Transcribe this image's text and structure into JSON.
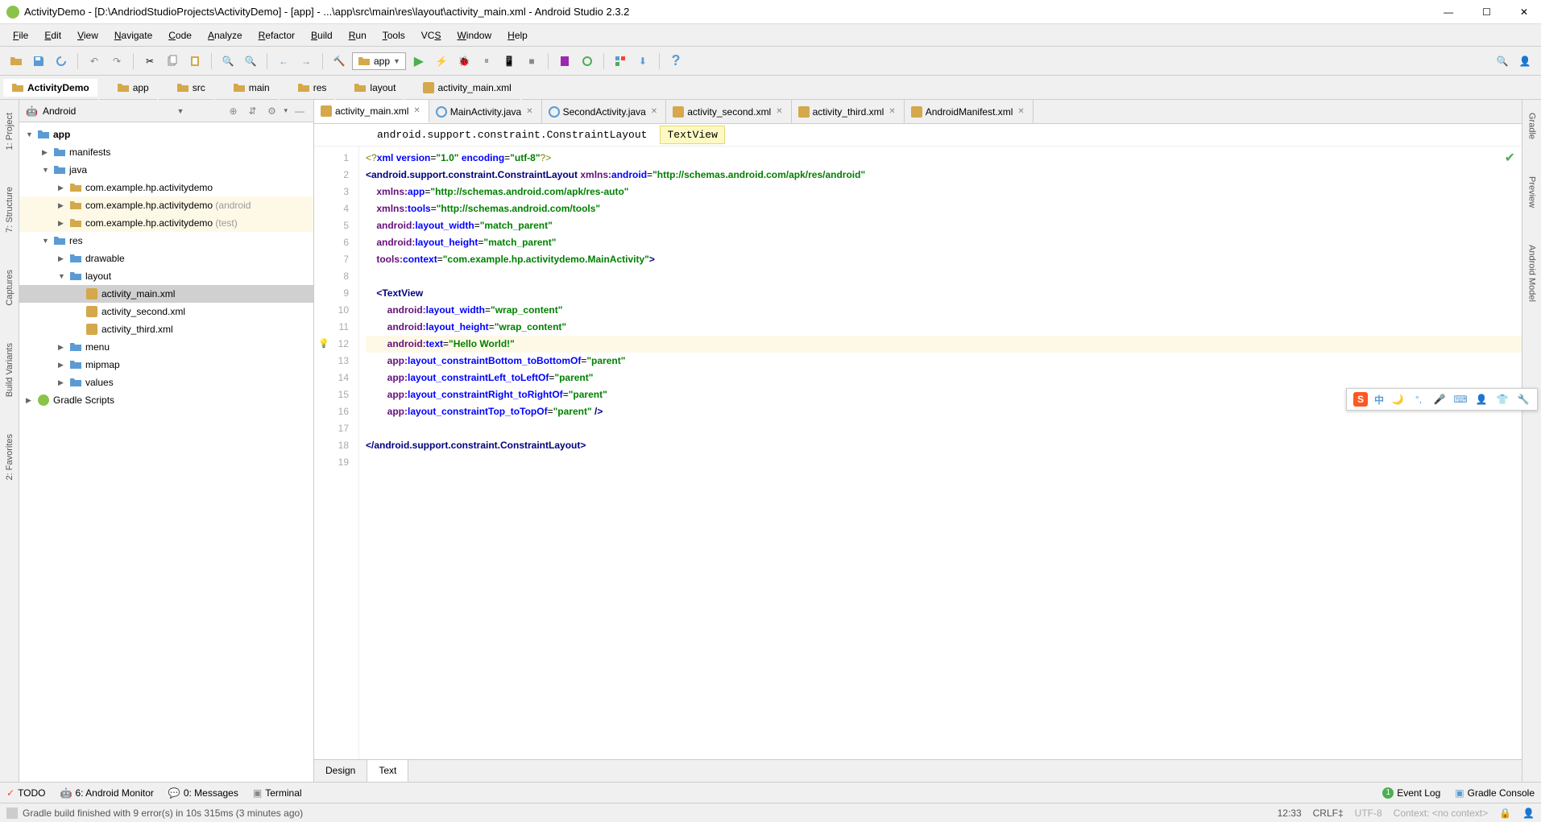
{
  "titlebar": {
    "title": "ActivityDemo - [D:\\AndriodStudioProjects\\ActivityDemo] - [app] - ...\\app\\src\\main\\res\\layout\\activity_main.xml - Android Studio 2.3.2"
  },
  "menubar": [
    {
      "label": "File",
      "key": "F"
    },
    {
      "label": "Edit",
      "key": "E"
    },
    {
      "label": "View",
      "key": "V"
    },
    {
      "label": "Navigate",
      "key": "N"
    },
    {
      "label": "Code",
      "key": "C"
    },
    {
      "label": "Analyze",
      "key": "A"
    },
    {
      "label": "Refactor",
      "key": "R"
    },
    {
      "label": "Build",
      "key": "B"
    },
    {
      "label": "Run",
      "key": "R"
    },
    {
      "label": "Tools",
      "key": "T"
    },
    {
      "label": "VCS",
      "key": "S"
    },
    {
      "label": "Window",
      "key": "W"
    },
    {
      "label": "Help",
      "key": "H"
    }
  ],
  "toolbar": {
    "run_config": "app"
  },
  "breadcrumb": [
    {
      "label": "ActivityDemo",
      "icon": "folder"
    },
    {
      "label": "app",
      "icon": "folder"
    },
    {
      "label": "src",
      "icon": "folder"
    },
    {
      "label": "main",
      "icon": "folder"
    },
    {
      "label": "res",
      "icon": "folder"
    },
    {
      "label": "layout",
      "icon": "folder"
    },
    {
      "label": "activity_main.xml",
      "icon": "xml"
    }
  ],
  "side_tabs_left": [
    {
      "label": "1: Project"
    },
    {
      "label": "7: Structure"
    },
    {
      "label": "Captures"
    },
    {
      "label": "Build Variants"
    },
    {
      "label": "2: Favorites"
    }
  ],
  "side_tabs_right": [
    {
      "label": "Gradle"
    },
    {
      "label": "Preview"
    },
    {
      "label": "Android Model"
    }
  ],
  "project_panel": {
    "view": "Android",
    "tree": [
      {
        "label": "app",
        "icon": "folder",
        "expanded": true,
        "bold": true,
        "indent": 0
      },
      {
        "label": "manifests",
        "icon": "folder",
        "expanded": false,
        "indent": 1
      },
      {
        "label": "java",
        "icon": "folder",
        "expanded": true,
        "indent": 1
      },
      {
        "label": "com.example.hp.activitydemo",
        "icon": "package",
        "expanded": false,
        "indent": 2
      },
      {
        "label": "com.example.hp.activitydemo",
        "suffix": " (android",
        "icon": "package",
        "expanded": false,
        "indent": 2,
        "highlighted": true
      },
      {
        "label": "com.example.hp.activitydemo",
        "suffix": " (test)",
        "icon": "package",
        "expanded": false,
        "indent": 2,
        "highlighted": true
      },
      {
        "label": "res",
        "icon": "folder",
        "expanded": true,
        "indent": 1
      },
      {
        "label": "drawable",
        "icon": "folder",
        "expanded": false,
        "indent": 2
      },
      {
        "label": "layout",
        "icon": "folder",
        "expanded": true,
        "indent": 2
      },
      {
        "label": "activity_main.xml",
        "icon": "xml",
        "indent": 3,
        "selected": true
      },
      {
        "label": "activity_second.xml",
        "icon": "xml",
        "indent": 3
      },
      {
        "label": "activity_third.xml",
        "icon": "xml",
        "indent": 3
      },
      {
        "label": "menu",
        "icon": "folder",
        "expanded": false,
        "indent": 2
      },
      {
        "label": "mipmap",
        "icon": "folder",
        "expanded": false,
        "indent": 2
      },
      {
        "label": "values",
        "icon": "folder",
        "expanded": false,
        "indent": 2
      },
      {
        "label": "Gradle Scripts",
        "icon": "gradle",
        "expanded": false,
        "indent": 0
      }
    ]
  },
  "editor": {
    "tabs": [
      {
        "label": "activity_main.xml",
        "icon": "xml",
        "active": true
      },
      {
        "label": "MainActivity.java",
        "icon": "java"
      },
      {
        "label": "SecondActivity.java",
        "icon": "java"
      },
      {
        "label": "activity_second.xml",
        "icon": "xml"
      },
      {
        "label": "activity_third.xml",
        "icon": "xml"
      },
      {
        "label": "AndroidManifest.xml",
        "icon": "xml"
      }
    ],
    "crumb": {
      "parent": "android.support.constraint.ConstraintLayout",
      "current": "TextView"
    },
    "lines": [
      {
        "n": 1,
        "html": "<span class='pi'>&lt;?</span><span class='attr'>xml version</span>=<span class='str'>\"1.0\"</span> <span class='attr'>encoding</span>=<span class='str'>\"utf-8\"</span><span class='pi'>?&gt;</span>"
      },
      {
        "n": 2,
        "html": "<span class='tag'>&lt;android.support.constraint.ConstraintLayout</span> <span class='attr-ns'>xmlns:</span><span class='attr'>android</span>=<span class='str'>\"http://schemas.android.com/apk/res/android\"</span>"
      },
      {
        "n": 3,
        "html": "    <span class='attr-ns'>xmlns:</span><span class='attr'>app</span>=<span class='str'>\"http://schemas.android.com/apk/res-auto\"</span>"
      },
      {
        "n": 4,
        "html": "    <span class='attr-ns'>xmlns:</span><span class='attr'>tools</span>=<span class='str'>\"http://schemas.android.com/tools\"</span>"
      },
      {
        "n": 5,
        "html": "    <span class='attr-ns'>android:</span><span class='attr'>layout_width</span>=<span class='str'>\"match_parent\"</span>"
      },
      {
        "n": 6,
        "html": "    <span class='attr-ns'>android:</span><span class='attr'>layout_height</span>=<span class='str'>\"match_parent\"</span>"
      },
      {
        "n": 7,
        "html": "    <span class='attr-ns'>tools:</span><span class='attr'>context</span>=<span class='str'>\"com.example.hp.activitydemo.MainActivity\"</span><span class='tag'>&gt;</span>"
      },
      {
        "n": 8,
        "html": ""
      },
      {
        "n": 9,
        "html": "    <span class='tag'>&lt;TextView</span>"
      },
      {
        "n": 10,
        "html": "        <span class='attr-ns'>android:</span><span class='attr'>layout_width</span>=<span class='str'>\"wrap_content\"</span>"
      },
      {
        "n": 11,
        "html": "        <span class='attr-ns'>android:</span><span class='attr'>layout_height</span>=<span class='str'>\"wrap_content\"</span>"
      },
      {
        "n": 12,
        "html": "        <span class='attr-ns'>android:</span><span class='attr'>text</span>=<span class='str'>\"Hello World!\"</span>",
        "hl": true,
        "bulb": true
      },
      {
        "n": 13,
        "html": "        <span class='attr-ns'>app:</span><span class='attr'>layout_constraintBottom_toBottomOf</span>=<span class='str'>\"parent\"</span>"
      },
      {
        "n": 14,
        "html": "        <span class='attr-ns'>app:</span><span class='attr'>layout_constraintLeft_toLeftOf</span>=<span class='str'>\"parent\"</span>"
      },
      {
        "n": 15,
        "html": "        <span class='attr-ns'>app:</span><span class='attr'>layout_constraintRight_toRightOf</span>=<span class='str'>\"parent\"</span>"
      },
      {
        "n": 16,
        "html": "        <span class='attr-ns'>app:</span><span class='attr'>layout_constraintTop_toTopOf</span>=<span class='str'>\"parent\"</span> <span class='tag'>/&gt;</span>"
      },
      {
        "n": 17,
        "html": ""
      },
      {
        "n": 18,
        "html": "<span class='tag'>&lt;/android.support.constraint.ConstraintLayout&gt;</span>"
      },
      {
        "n": 19,
        "html": ""
      }
    ],
    "bottom_tabs": [
      {
        "label": "Design"
      },
      {
        "label": "Text",
        "active": true
      }
    ]
  },
  "bottom_toolbar": [
    {
      "label": "TODO",
      "icon": "todo"
    },
    {
      "label": "6: Android Monitor",
      "icon": "android"
    },
    {
      "label": "0: Messages",
      "icon": "messages"
    },
    {
      "label": "Terminal",
      "icon": "terminal"
    }
  ],
  "bottom_right": [
    {
      "label": "Event Log",
      "icon": "event"
    },
    {
      "label": "Gradle Console",
      "icon": "gradle"
    }
  ],
  "statusbar": {
    "message": "Gradle build finished with 9 error(s) in 10s 315ms (3 minutes ago)",
    "cursor": "12:33",
    "line_sep": "CRLF",
    "encoding": "UTF-8",
    "context": "Context: <no context>"
  },
  "ime": {
    "mode": "中"
  }
}
